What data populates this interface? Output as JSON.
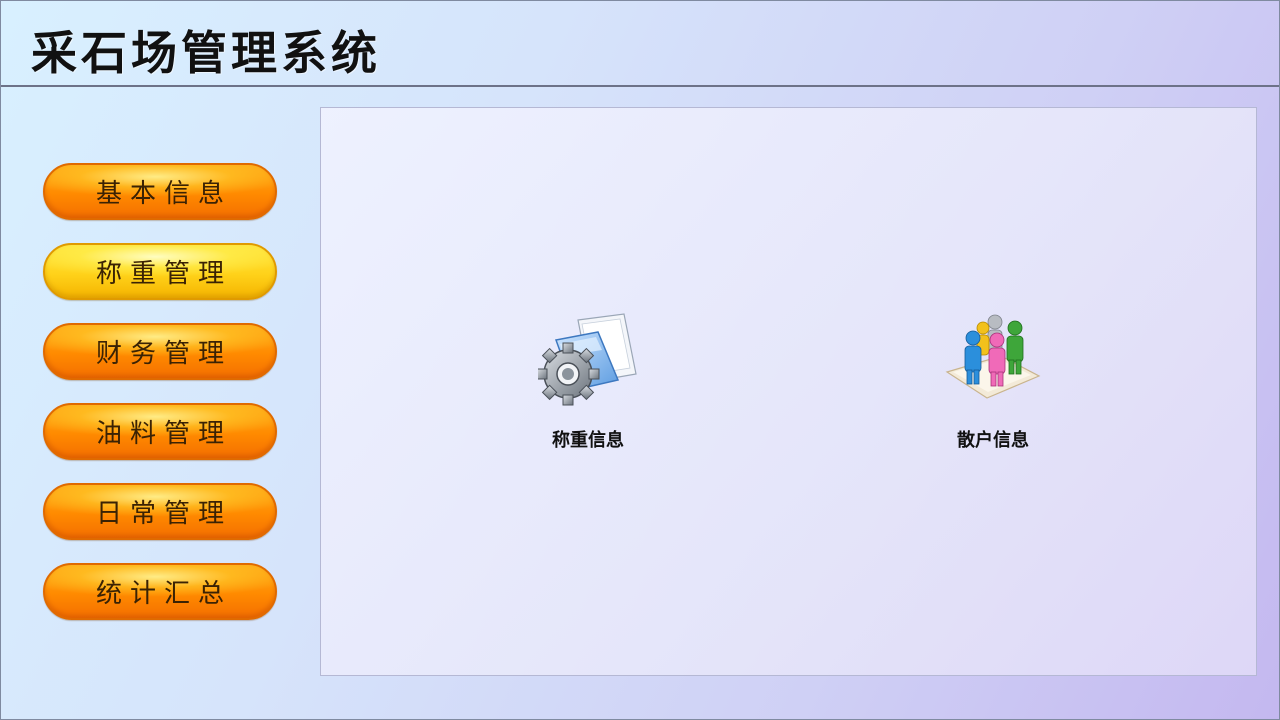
{
  "app": {
    "title": "采石场管理系统"
  },
  "sidebar": {
    "items": [
      {
        "label": "基本信息",
        "active": false
      },
      {
        "label": "称重管理",
        "active": true
      },
      {
        "label": "财务管理",
        "active": false
      },
      {
        "label": "油料管理",
        "active": false
      },
      {
        "label": "日常管理",
        "active": false
      },
      {
        "label": "统计汇总",
        "active": false
      }
    ]
  },
  "main": {
    "shortcuts": [
      {
        "label": "称重信息",
        "icon": "folder-settings-icon"
      },
      {
        "label": "散户信息",
        "icon": "people-group-icon"
      }
    ]
  },
  "colors": {
    "button_orange": "#ff8a00",
    "button_active_yellow": "#ffd21a",
    "header_border": "#6d7288"
  }
}
